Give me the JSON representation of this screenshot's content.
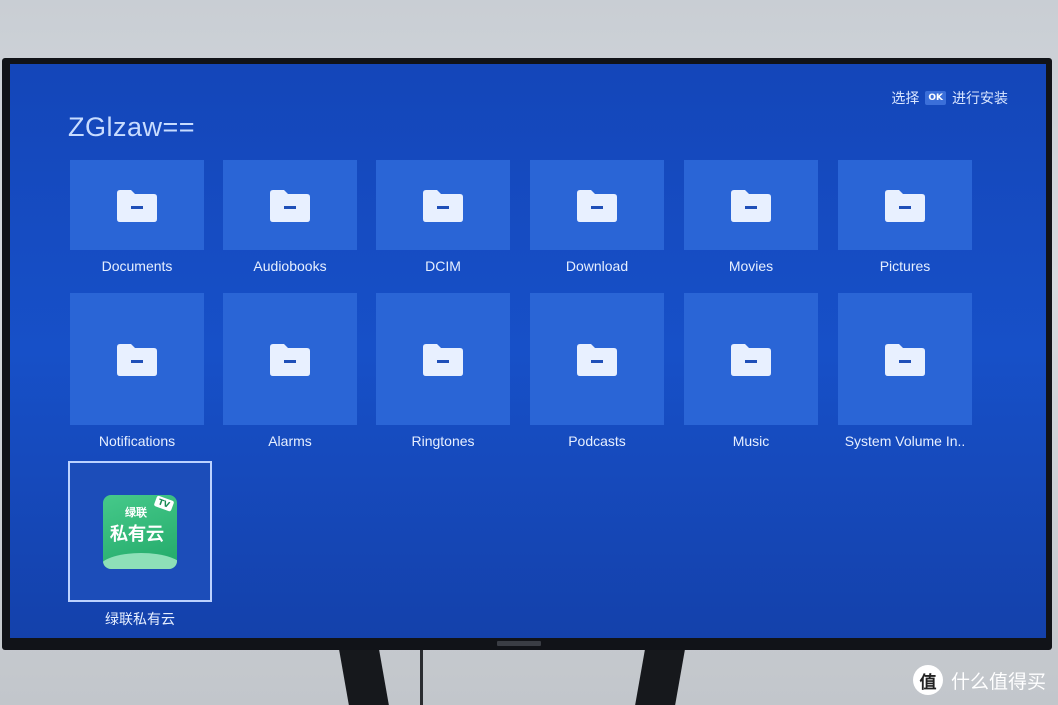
{
  "screen": {
    "folder_title": "ZGlzaw==",
    "hint": {
      "prefix": "选择",
      "key": "OK",
      "suffix": "进行安装"
    },
    "folders": [
      "Documents",
      "Audiobooks",
      "DCIM",
      "Download",
      "Movies",
      "Pictures",
      "Notifications",
      "Alarms",
      "Ringtones",
      "Podcasts",
      "Music",
      "System Volume In.."
    ],
    "app": {
      "label": "绿联私有云",
      "icon_line1": "绿联",
      "icon_line2": "私有云",
      "icon_badge": "TV"
    }
  },
  "watermark": {
    "logo": "值",
    "text": "什么值得买"
  },
  "colors": {
    "screen_bg": "#1750c8",
    "tile_bg": "#2a65d6",
    "folder_icon": "#e8f0ff",
    "app_green": "#2bb574"
  }
}
